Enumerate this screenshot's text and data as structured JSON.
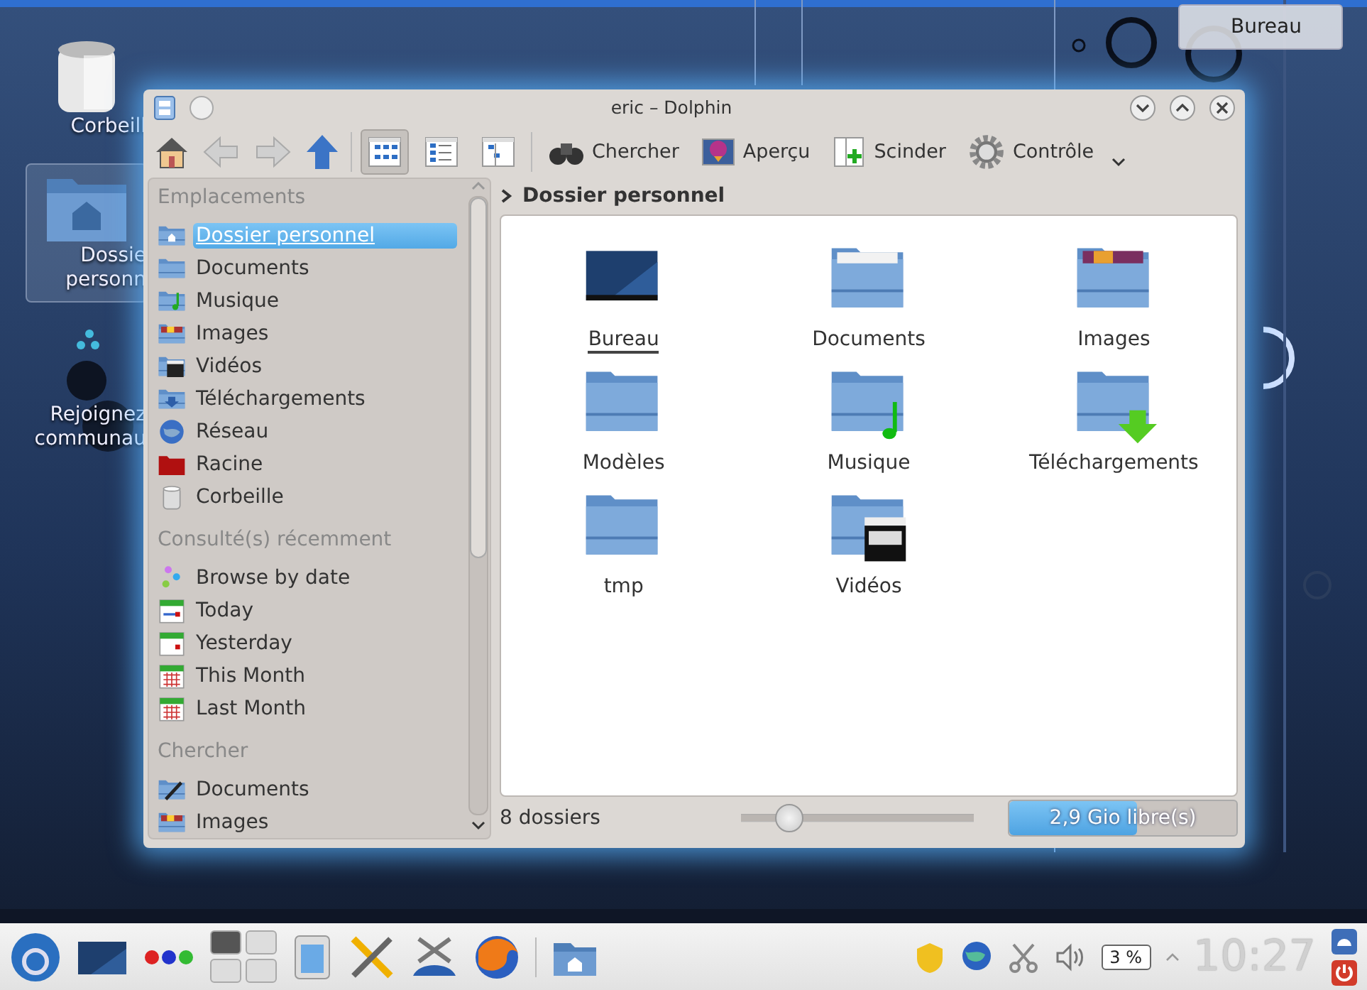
{
  "desktop": {
    "icons": [
      {
        "kind": "trash",
        "lines": [
          "Corbeill"
        ],
        "selected": false
      },
      {
        "kind": "home",
        "lines": [
          "Dossie",
          "personn"
        ],
        "selected": true
      },
      {
        "kind": "community",
        "lines": [
          "Rejoignez",
          "communau"
        ],
        "selected": false
      }
    ],
    "bureau_button": "Bureau"
  },
  "window": {
    "title": "eric – Dolphin",
    "view_modes": [
      {
        "kind": "icons",
        "selected": true
      },
      {
        "kind": "details",
        "selected": false
      },
      {
        "kind": "columns",
        "selected": false
      }
    ],
    "toolbar": [
      {
        "kind": "search",
        "label": "Chercher"
      },
      {
        "kind": "preview",
        "label": "Aperçu"
      },
      {
        "kind": "split",
        "label": "Scinder"
      },
      {
        "kind": "gear",
        "label": "Contrôle"
      }
    ],
    "sidebar": [
      {
        "title": "Emplacements",
        "items": [
          {
            "kind": "home",
            "label": "Dossier personnel",
            "selected": true
          },
          {
            "kind": "folder",
            "label": "Documents",
            "selected": false
          },
          {
            "kind": "music",
            "label": "Musique",
            "selected": false
          },
          {
            "kind": "images",
            "label": "Images",
            "selected": false
          },
          {
            "kind": "video",
            "label": "Vidéos",
            "selected": false
          },
          {
            "kind": "download",
            "label": "Téléchargements",
            "selected": false
          },
          {
            "kind": "network",
            "label": "Réseau",
            "selected": false
          },
          {
            "kind": "root",
            "label": "Racine",
            "selected": false
          },
          {
            "kind": "trash",
            "label": "Corbeille",
            "selected": false
          }
        ]
      },
      {
        "title": "Consulté(s) récemment",
        "items": [
          {
            "kind": "dots",
            "label": "Browse by date",
            "selected": false
          },
          {
            "kind": "today",
            "label": "Today",
            "selected": false
          },
          {
            "kind": "yesterday",
            "label": "Yesterday",
            "selected": false
          },
          {
            "kind": "month",
            "label": "This Month",
            "selected": false
          },
          {
            "kind": "month",
            "label": "Last Month",
            "selected": false
          }
        ]
      },
      {
        "title": "Chercher",
        "items": [
          {
            "kind": "edit",
            "label": "Documents",
            "selected": false
          },
          {
            "kind": "images",
            "label": "Images",
            "selected": false
          }
        ]
      }
    ],
    "breadcrumb": "Dossier personnel",
    "files": [
      {
        "kind": "desktop",
        "name": "Bureau",
        "selected": true
      },
      {
        "kind": "documents",
        "name": "Documents",
        "selected": false
      },
      {
        "kind": "images",
        "name": "Images",
        "selected": false
      },
      {
        "kind": "folder",
        "name": "Modèles",
        "selected": false
      },
      {
        "kind": "music",
        "name": "Musique",
        "selected": false
      },
      {
        "kind": "download",
        "name": "Téléchargements",
        "selected": false
      },
      {
        "kind": "folder",
        "name": "tmp",
        "selected": false
      },
      {
        "kind": "video",
        "name": "Vidéos",
        "selected": false
      }
    ],
    "status": {
      "text": "8 dossiers",
      "zoom": {
        "level": 0.2
      },
      "free_space": {
        "text": "2,9 Gio libre(s)",
        "level": 0.56
      }
    }
  },
  "taskbar": {
    "pager": [
      {
        "selected": true
      },
      {
        "selected": false
      },
      {
        "selected": false
      },
      {
        "selected": false
      }
    ],
    "battery": "3 %",
    "clock": "10:27"
  }
}
